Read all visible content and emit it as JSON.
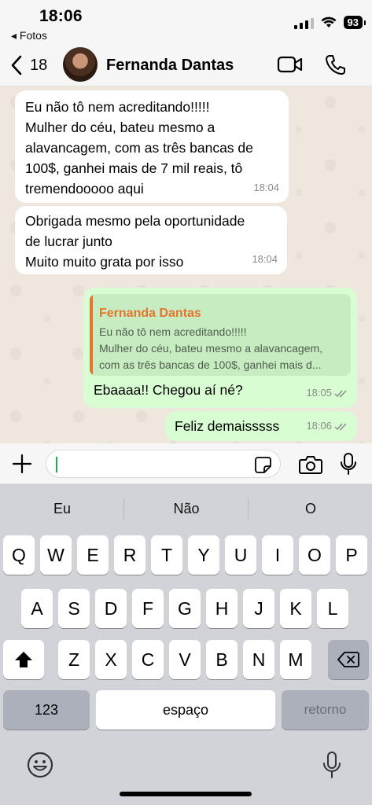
{
  "status_bar": {
    "time": "18:06",
    "back_app": "◂ Fotos",
    "battery": "93"
  },
  "header": {
    "unread_count": "18",
    "contact_name": "Fernanda Dantas"
  },
  "messages": [
    {
      "direction": "in",
      "text": "Eu não tô nem acreditando!!!!!\nMulher do céu, bateu mesmo a\nalavancagem, com as três bancas de\n100$, ganhei mais de 7 mil reais, tô\ntremendooooo aqui",
      "time": "18:04"
    },
    {
      "direction": "in",
      "text": "Obrigada mesmo pela oportunidade\nde lucrar junto\nMuito muito grata por isso",
      "time": "18:04"
    },
    {
      "direction": "out",
      "quote_name": "Fernanda Dantas",
      "quote_text": "Eu não tô nem acreditando!!!!!\nMulher do céu, bateu mesmo a alavancagem,\ncom as três bancas de 100$, ganhei mais d...",
      "text": "Ebaaaa!! Chegou aí né?",
      "time": "18:05"
    },
    {
      "direction": "out",
      "text": "Feliz demaisssss",
      "time": "18:06"
    }
  ],
  "composer": {
    "value": "",
    "placeholder": ""
  },
  "keyboard": {
    "suggestions": [
      "Eu",
      "Não",
      "O"
    ],
    "row1": [
      "Q",
      "W",
      "E",
      "R",
      "T",
      "Y",
      "U",
      "I",
      "O",
      "P"
    ],
    "row2": [
      "A",
      "S",
      "D",
      "F",
      "G",
      "H",
      "J",
      "K",
      "L"
    ],
    "row3": [
      "Z",
      "X",
      "C",
      "V",
      "B",
      "N",
      "M"
    ],
    "numbers_label": "123",
    "space_label": "espaço",
    "return_label": "retorno"
  },
  "colors": {
    "outgoing_bubble": "#d8fdd2",
    "incoming_bubble": "#ffffff",
    "quote_accent": "#e5742f",
    "read_ticks": "#8a8a8a"
  }
}
